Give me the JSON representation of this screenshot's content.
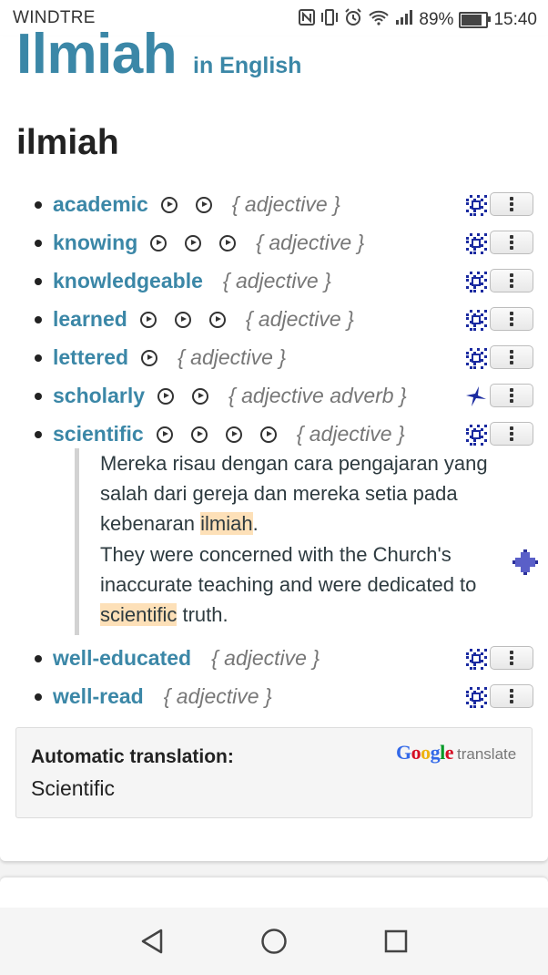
{
  "status_bar": {
    "carrier": "WINDTRE",
    "battery": "89%",
    "battery_level": 0.89,
    "time": "15:40",
    "icons": [
      "nfc-icon",
      "vibrate-icon",
      "alarm-icon",
      "wifi-icon",
      "signal-icon",
      "battery-icon"
    ]
  },
  "header": {
    "title": "Ilmiah",
    "subtitle": "in English",
    "headword": "ilmiah"
  },
  "translations": [
    {
      "word": "academic",
      "audio_count": 2,
      "pos": "{ adjective }",
      "icon": "dots-icon"
    },
    {
      "word": "knowing",
      "audio_count": 3,
      "pos": "{ adjective }",
      "icon": "dots-icon"
    },
    {
      "word": "knowledgeable",
      "audio_count": 0,
      "pos": "{ adjective }",
      "icon": "dots-icon"
    },
    {
      "word": "learned",
      "audio_count": 3,
      "pos": "{ adjective }",
      "icon": "dots-icon"
    },
    {
      "word": "lettered",
      "audio_count": 1,
      "pos": "{ adjective }",
      "icon": "dots-icon"
    },
    {
      "word": "scholarly",
      "audio_count": 2,
      "pos": "{ adjective adverb }",
      "icon": "star-icon"
    },
    {
      "word": "scientific",
      "audio_count": 4,
      "pos": "{ adjective }",
      "icon": "dots-icon"
    },
    {
      "word": "well-educated",
      "audio_count": 0,
      "pos": "{ adjective }",
      "icon": "dots-icon"
    },
    {
      "word": "well-read",
      "audio_count": 0,
      "pos": "{ adjective }",
      "icon": "dots-icon"
    }
  ],
  "example": {
    "source_before": "Mereka risau dengan cara pengajaran yang salah dari gereja dan mereka setia pada kebenaran ",
    "source_highlight": "ilmiah",
    "source_after": ".",
    "target_before": "They were concerned with the Church's inaccurate teaching and were dedicated to ",
    "target_highlight": "scientific",
    "target_after": " truth."
  },
  "auto_translation": {
    "label": "Automatic translation:",
    "value": "Scientific",
    "brand": "Google",
    "brand_suffix": "translate"
  },
  "colors": {
    "accent": "#3b87a7",
    "icon_blue": "#1a2aa0",
    "highlight": "#fde0b8"
  },
  "nav": [
    "back-icon",
    "home-icon",
    "recents-icon"
  ]
}
